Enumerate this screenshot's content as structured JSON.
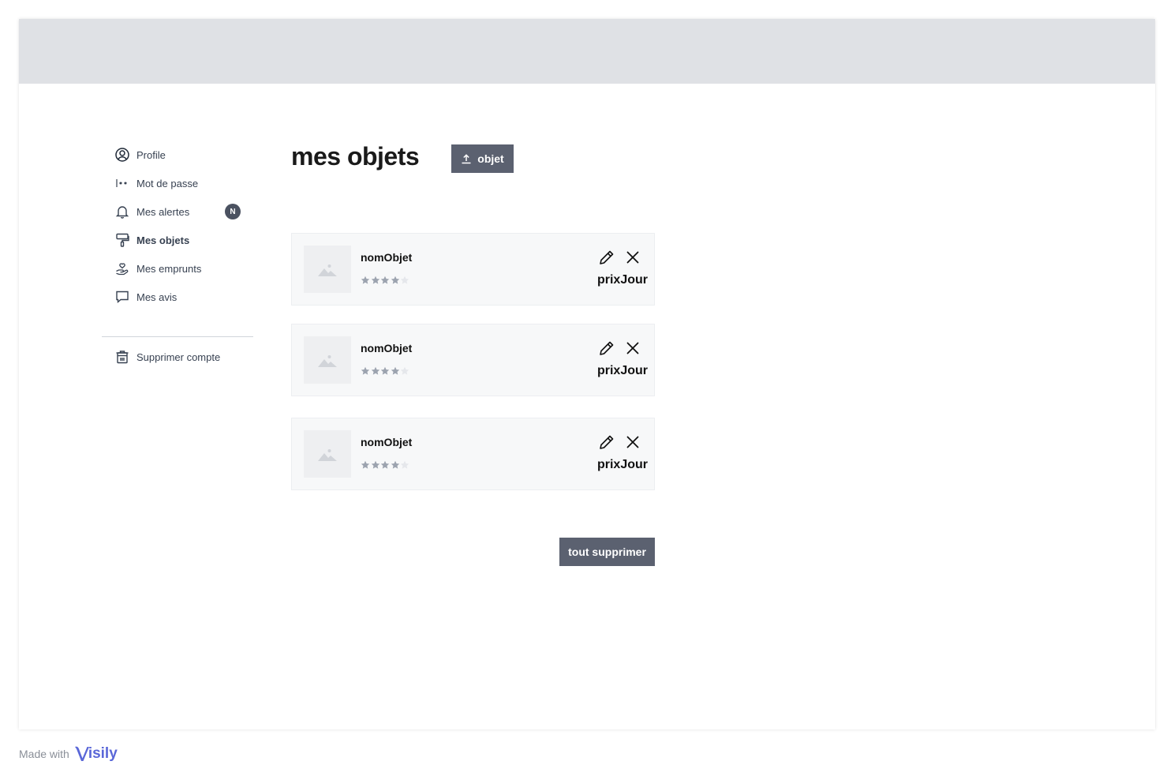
{
  "sidebar": {
    "items": [
      {
        "label": "Profile",
        "icon": "user-circle-icon"
      },
      {
        "label": "Mot de passe",
        "icon": "password-icon"
      },
      {
        "label": "Mes alertes",
        "icon": "bell-icon",
        "badge": "N"
      },
      {
        "label": "Mes objets",
        "icon": "paint-roller-icon",
        "active": true
      },
      {
        "label": "Mes emprunts",
        "icon": "hand-heart-icon"
      },
      {
        "label": "Mes avis",
        "icon": "chat-bubble-icon"
      }
    ],
    "delete_account": {
      "label": "Supprimer compte",
      "icon": "trash-icon"
    }
  },
  "main": {
    "title": "mes objets",
    "upload_button": {
      "label": "objet",
      "icon": "upload-icon"
    },
    "items": [
      {
        "name": "nomObjet",
        "price": "prixJour",
        "rating": 4,
        "rating_max": 5
      },
      {
        "name": "nomObjet",
        "price": "prixJour",
        "rating": 4,
        "rating_max": 5
      },
      {
        "name": "nomObjet",
        "price": "prixJour",
        "rating": 4,
        "rating_max": 5
      }
    ],
    "delete_all_label": "tout supprimer"
  },
  "footer": {
    "made_with": "Made with",
    "brand": "isily"
  },
  "colors": {
    "topbar": "#dfe1e5",
    "button": "#5b6170",
    "badge": "#4b5261",
    "card": "#f7f8f9",
    "star_filled": "#9ca3af",
    "star_empty": "#e5e7eb",
    "brand": "#5a67d8"
  }
}
